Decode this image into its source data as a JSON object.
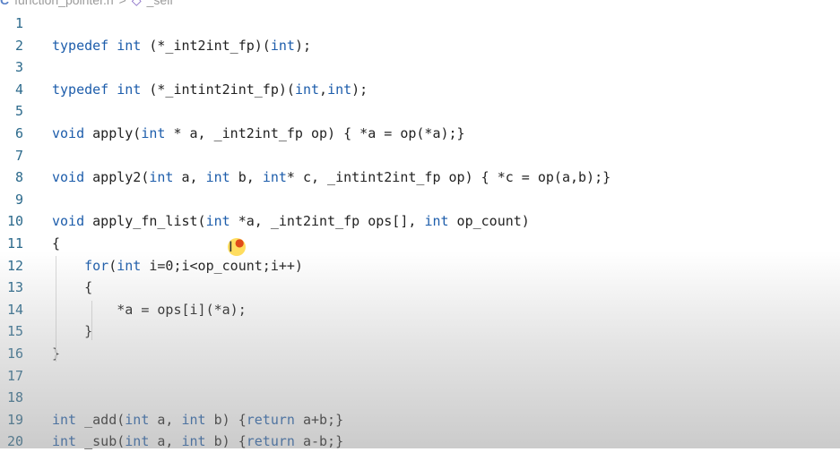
{
  "breadcrumb": {
    "icon": "c-file-icon",
    "file": "function_pointer.h",
    "separator": ">",
    "symbol_icon": "symbol-icon",
    "symbol": "_self"
  },
  "editor": {
    "lines": [
      {
        "n": "1",
        "code": ""
      },
      {
        "n": "2",
        "code": "typedef int (*_int2int_fp)(int);"
      },
      {
        "n": "3",
        "code": ""
      },
      {
        "n": "4",
        "code": "typedef int (*_intint2int_fp)(int,int);"
      },
      {
        "n": "5",
        "code": ""
      },
      {
        "n": "6",
        "code": "void apply(int * a, _int2int_fp op) { *a = op(*a);}"
      },
      {
        "n": "7",
        "code": ""
      },
      {
        "n": "8",
        "code": "void apply2(int a, int b, int* c, _intint2int_fp op) { *c = op(a,b);}"
      },
      {
        "n": "9",
        "code": ""
      },
      {
        "n": "10",
        "code": "void apply_fn_list(int *a, _int2int_fp ops[], int op_count)"
      },
      {
        "n": "11",
        "code": "{"
      },
      {
        "n": "12",
        "code": "    for(int i=0;i<op_count;i++)"
      },
      {
        "n": "13",
        "code": "    {"
      },
      {
        "n": "14",
        "code": "        *a = ops[i](*a);"
      },
      {
        "n": "15",
        "code": "    }"
      },
      {
        "n": "16",
        "code": "}"
      },
      {
        "n": "17",
        "code": ""
      },
      {
        "n": "18",
        "code": ""
      },
      {
        "n": "19",
        "code": "int _add(int a, int b) {return a+b;}"
      },
      {
        "n": "20",
        "code": "int _sub(int a, int b) {return a-b;}"
      }
    ]
  },
  "cursor": {
    "icon": "text-cursor-icon"
  }
}
